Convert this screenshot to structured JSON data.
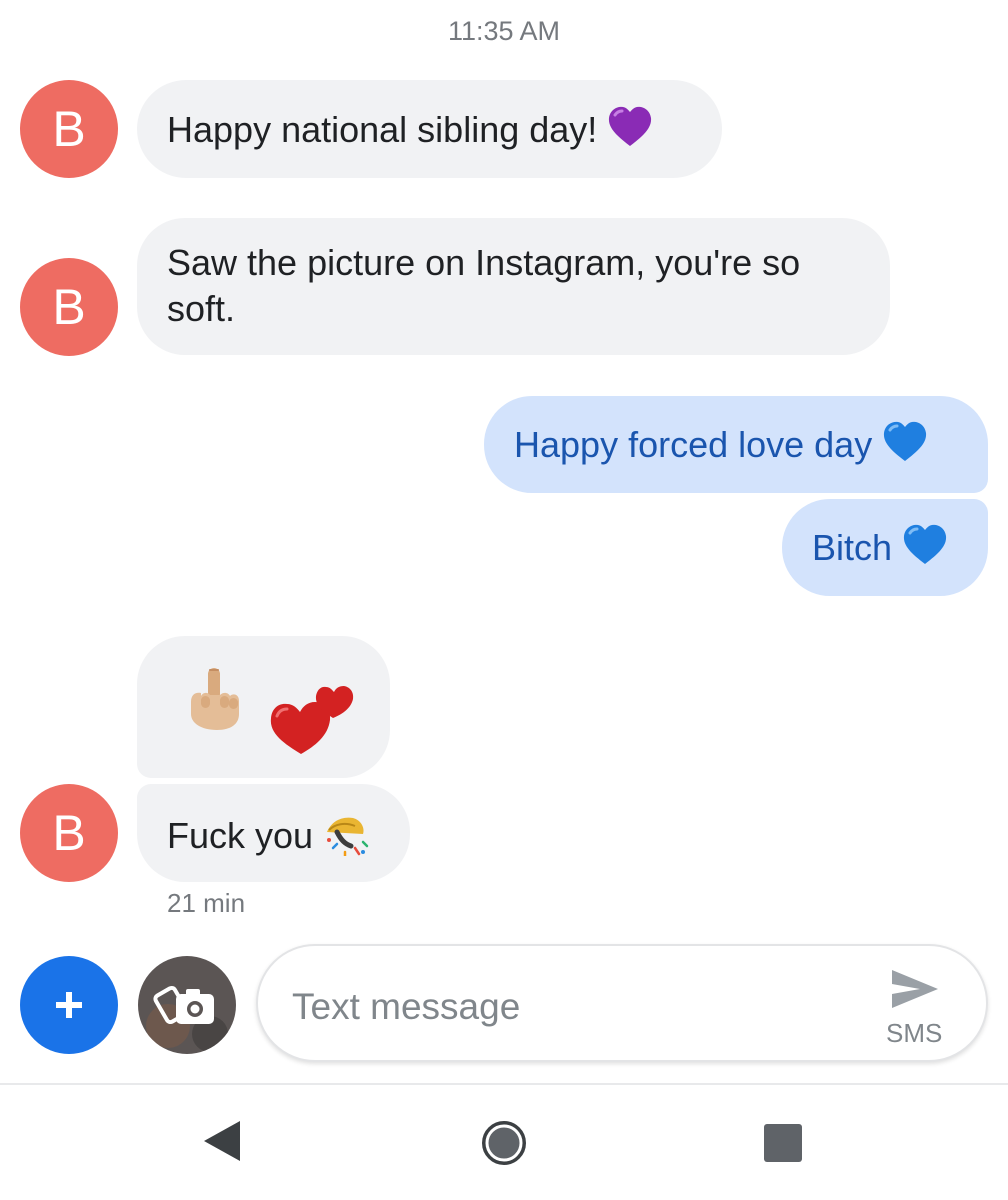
{
  "conversation": {
    "timestamp": "11:35 AM",
    "contact_initial": "B",
    "messages": [
      {
        "direction": "incoming",
        "text": "Happy national sibling day!",
        "emoji": "purple-heart"
      },
      {
        "direction": "incoming",
        "text": "Saw the picture on Instagram, you're so soft."
      },
      {
        "direction": "outgoing",
        "text": "Happy forced love day",
        "emoji": "blue-heart"
      },
      {
        "direction": "outgoing",
        "text": "Bitch",
        "emoji": "blue-heart"
      },
      {
        "direction": "incoming",
        "emoji_only": [
          "middle-finger",
          "two-hearts"
        ]
      },
      {
        "direction": "incoming",
        "text": "Fuck you",
        "emoji": "party-popper"
      }
    ],
    "last_message_time": "21 min"
  },
  "compose": {
    "placeholder": "Text message",
    "send_type": "SMS"
  },
  "colors": {
    "avatar": "#ee6c62",
    "incoming_bubble": "#f1f2f4",
    "outgoing_bubble": "#d3e3fc",
    "outgoing_text": "#1a55ae",
    "fab": "#1a73e8"
  },
  "icons": {
    "attach": "plus-icon",
    "media": "camera-icon",
    "send": "send-icon",
    "nav_back": "back-triangle-icon",
    "nav_home": "home-circle-icon",
    "nav_recents": "recents-square-icon"
  }
}
